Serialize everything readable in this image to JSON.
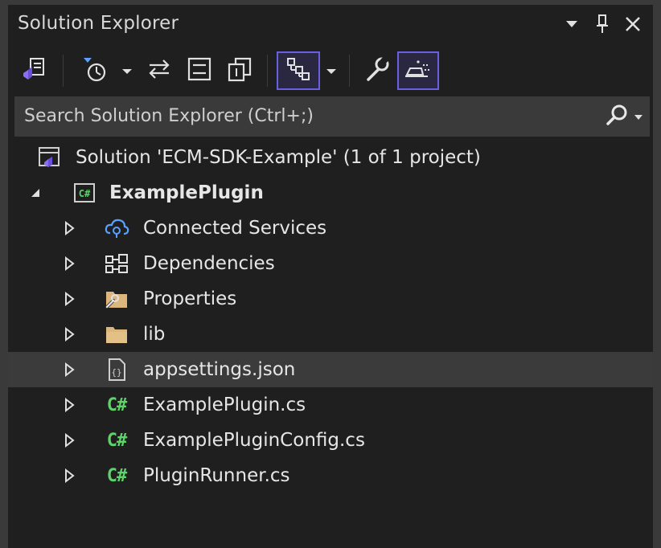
{
  "panel": {
    "title": "Solution Explorer",
    "controls": [
      "dropdown-icon",
      "pin-icon",
      "close-icon"
    ]
  },
  "toolbar": {
    "buttons": [
      {
        "name": "switch-views",
        "icon": "vs-solution-switch-icon"
      },
      {
        "name": "pending-changes-filter",
        "icon": "clock-filter-icon",
        "has_dropdown": true
      },
      {
        "name": "sync-with-active-document",
        "icon": "sync-arrows-icon"
      },
      {
        "name": "collapse-all",
        "icon": "collapse-all-icon"
      },
      {
        "name": "show-all-files",
        "icon": "show-all-files-icon"
      },
      {
        "name": "view-class-diagram",
        "icon": "class-view-icon",
        "checked": true,
        "has_dropdown": true
      },
      {
        "name": "properties",
        "icon": "wrench-icon"
      },
      {
        "name": "preview-selected-items",
        "icon": "preview-icon",
        "checked": true
      }
    ]
  },
  "search": {
    "placeholder": "Search Solution Explorer (Ctrl+;)"
  },
  "tree": {
    "solution_label": "Solution 'ECM-SDK-Example' (1 of 1 project)",
    "project_label": "ExamplePlugin",
    "items": [
      {
        "label": "Connected Services",
        "icon": "connected-services-icon"
      },
      {
        "label": "Dependencies",
        "icon": "dependencies-icon"
      },
      {
        "label": "Properties",
        "icon": "properties-folder-icon"
      },
      {
        "label": "lib",
        "icon": "folder-icon"
      },
      {
        "label": "appsettings.json",
        "icon": "json-file-icon",
        "selected": true
      },
      {
        "label": "ExamplePlugin.cs",
        "icon": "csharp-file-icon",
        "glyph": "C#"
      },
      {
        "label": "ExamplePluginConfig.cs",
        "icon": "csharp-file-icon",
        "glyph": "C#"
      },
      {
        "label": "PluginRunner.cs",
        "icon": "csharp-file-icon",
        "glyph": "C#"
      }
    ]
  },
  "colors": {
    "panel_bg": "#1f1f1f",
    "search_bg": "#3a3a3a",
    "selected_row": "#3b3b3b",
    "accent_checked": "#6a5fe0",
    "csharp_green": "#5ed36a",
    "folder_yellow": "#dcb67a"
  }
}
